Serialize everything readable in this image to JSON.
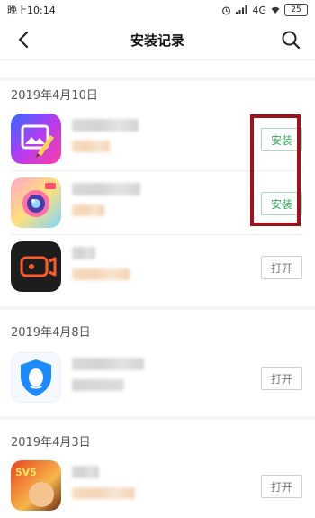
{
  "status_bar": {
    "time": "晚上10:14",
    "network": "4G",
    "battery": "25"
  },
  "header": {
    "title": "安装记录"
  },
  "sections": [
    {
      "date": "2019年4月10日",
      "apps": [
        {
          "action": "安装",
          "icon": "photo-editor-app-icon"
        },
        {
          "action": "安装",
          "icon": "beauty-camera-app-icon"
        },
        {
          "action": "打开",
          "icon": "video-recorder-app-icon"
        }
      ]
    },
    {
      "date": "2019年4月8日",
      "apps": [
        {
          "action": "打开",
          "icon": "qq-security-app-icon"
        }
      ]
    },
    {
      "date": "2019年4月3日",
      "apps": [
        {
          "action": "打开",
          "icon": "game-app-icon",
          "icon_text": "5V5"
        }
      ]
    }
  ],
  "colors": {
    "install_text": "#2faf5b",
    "highlight_border": "#a0111a",
    "open_text": "#777777"
  }
}
